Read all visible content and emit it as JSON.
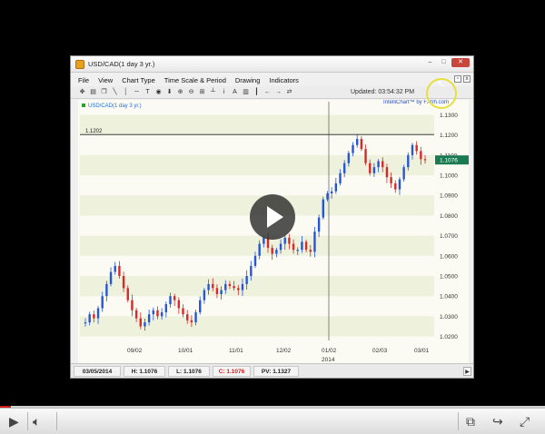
{
  "window": {
    "title": "USD/CAD(1 day  3 yr.)"
  },
  "menu": {
    "items": [
      "File",
      "View",
      "Chart Type",
      "Time Scale & Period",
      "Drawing",
      "Indicators"
    ]
  },
  "toolbar": {
    "updated_label": "Updated: 03:54:32 PM"
  },
  "chart": {
    "legend_label": "USD/CAD(1 day  3 yr.)",
    "brand": "IntelliChart™ by FXtrh.com",
    "reference_line_label": "1.1202",
    "current_price": "1.1076",
    "year_label": "2014"
  },
  "chart_data": {
    "type": "candlestick",
    "title": "USD/CAD(1 day  3 yr.)",
    "y_ticks": [
      "1.1300",
      "1.1200",
      "1.1100",
      "1.1000",
      "1.0900",
      "1.0800",
      "1.0700",
      "1.0600",
      "1.0500",
      "1.0400",
      "1.0300",
      "1.0200"
    ],
    "ylim": [
      1.018,
      1.132
    ],
    "x_ticks": [
      "09/02",
      "10/01",
      "11/01",
      "12/02",
      "01/02",
      "02/03",
      "03/01"
    ],
    "reference_line": 1.1202,
    "current_price": 1.1076,
    "series": [
      {
        "values": [
          1.027,
          1.031,
          1.029,
          1.034,
          1.04,
          1.046,
          1.052,
          1.055,
          1.05,
          1.044,
          1.038,
          1.033,
          1.029,
          1.025,
          1.027,
          1.031,
          1.033,
          1.03,
          1.032,
          1.036,
          1.04,
          1.038,
          1.034,
          1.031,
          1.028,
          1.027,
          1.032,
          1.038,
          1.043,
          1.046,
          1.044,
          1.041,
          1.043,
          1.046,
          1.045,
          1.044,
          1.043,
          1.046,
          1.05,
          1.055,
          1.06,
          1.066,
          1.069,
          1.064,
          1.061,
          1.063,
          1.066,
          1.069,
          1.066,
          1.063,
          1.063,
          1.067,
          1.063,
          1.062,
          1.072,
          1.079,
          1.088,
          1.091,
          1.092,
          1.096,
          1.101,
          1.106,
          1.111,
          1.115,
          1.118,
          1.113,
          1.106,
          1.101,
          1.104,
          1.107,
          1.104,
          1.099,
          1.096,
          1.093,
          1.098,
          1.104,
          1.11,
          1.115,
          1.112,
          1.108,
          1.1076
        ]
      }
    ]
  },
  "status": {
    "date": "03/05/2014",
    "high": "H: 1.1076",
    "low": "L: 1.1076",
    "close": "C: 1.1076",
    "pv": "PV: 1.1327"
  },
  "player": {
    "progress": 0.02
  },
  "icons": {
    "play": "play-icon",
    "volume": "volume-icon",
    "window": "window-icon",
    "share": "share-icon",
    "fullscreen": "fullscreen-icon"
  }
}
